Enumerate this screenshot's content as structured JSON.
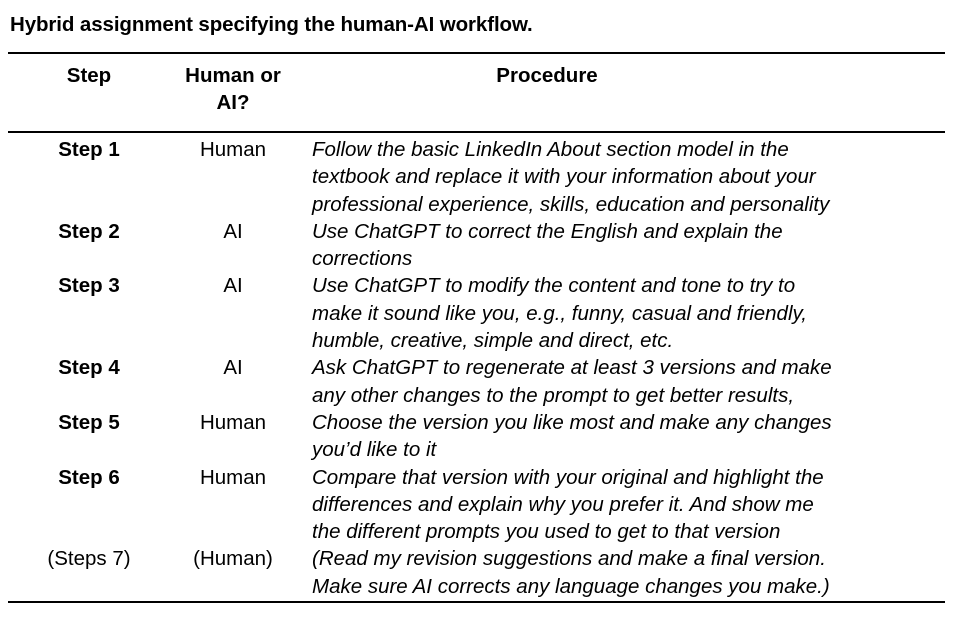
{
  "caption": "Hybrid assignment specifying the human-AI workflow.",
  "table": {
    "headers": {
      "step": "Step",
      "actor": "Human or AI?",
      "actor_line1": "Human or",
      "actor_line2": "AI?",
      "procedure": "Procedure"
    },
    "rows": [
      {
        "step": "Step 1",
        "actor": "Human",
        "procedure": "Follow the basic LinkedIn About section model in the textbook and replace it with your information about your professional experience, skills, education and personality",
        "lines": [
          "Follow the basic LinkedIn About section model in the",
          "textbook and replace it with your information about your",
          "professional experience, skills, education and personality"
        ],
        "optional": false
      },
      {
        "step": "Step 2",
        "actor": "AI",
        "procedure": "Use ChatGPT to correct the English and explain the corrections",
        "lines": [
          "Use ChatGPT to correct the English and explain the",
          "corrections"
        ],
        "optional": false
      },
      {
        "step": "Step 3",
        "actor": "AI",
        "procedure": "Use ChatGPT to modify the content and tone to try to make it sound like you, e.g., funny, casual and friendly, humble, creative, simple and direct, etc.",
        "lines": [
          "Use ChatGPT to modify the content and tone to try to",
          "make it sound like you, e.g., funny, casual and friendly,",
          "humble, creative, simple and direct, etc."
        ],
        "optional": false
      },
      {
        "step": "Step 4",
        "actor": "AI",
        "procedure": "Ask ChatGPT to regenerate at least 3 versions and make any other changes to the prompt to get better results,",
        "lines": [
          "Ask ChatGPT to regenerate at least 3 versions and make",
          "any other changes to the prompt to get better results,"
        ],
        "optional": false
      },
      {
        "step": "Step 5",
        "actor": "Human",
        "procedure": "Choose the version you like most and make any changes you’d like to it",
        "lines": [
          "Choose the version you like most and make any changes",
          "you’d like to it"
        ],
        "optional": false
      },
      {
        "step": "Step 6",
        "actor": "Human",
        "procedure": "Compare that version with your original and highlight the differences and explain why you prefer it. And show me the different prompts you used to get to that version",
        "lines": [
          "Compare that version with your original and highlight the",
          "differences and explain why you prefer it. And show me",
          "the different prompts you used to get to that version"
        ],
        "optional": false
      },
      {
        "step": "(Steps 7)",
        "actor": "(Human)",
        "procedure": "(Read my revision suggestions and make a final version. Make sure AI corrects any language changes you make.)",
        "lines": [
          "(Read my revision suggestions and make a final version.",
          "Make sure AI corrects any language changes you make.)"
        ],
        "optional": true
      }
    ]
  },
  "colors": {
    "background": "#ffffff",
    "text": "#000000",
    "rule": "#000000"
  }
}
